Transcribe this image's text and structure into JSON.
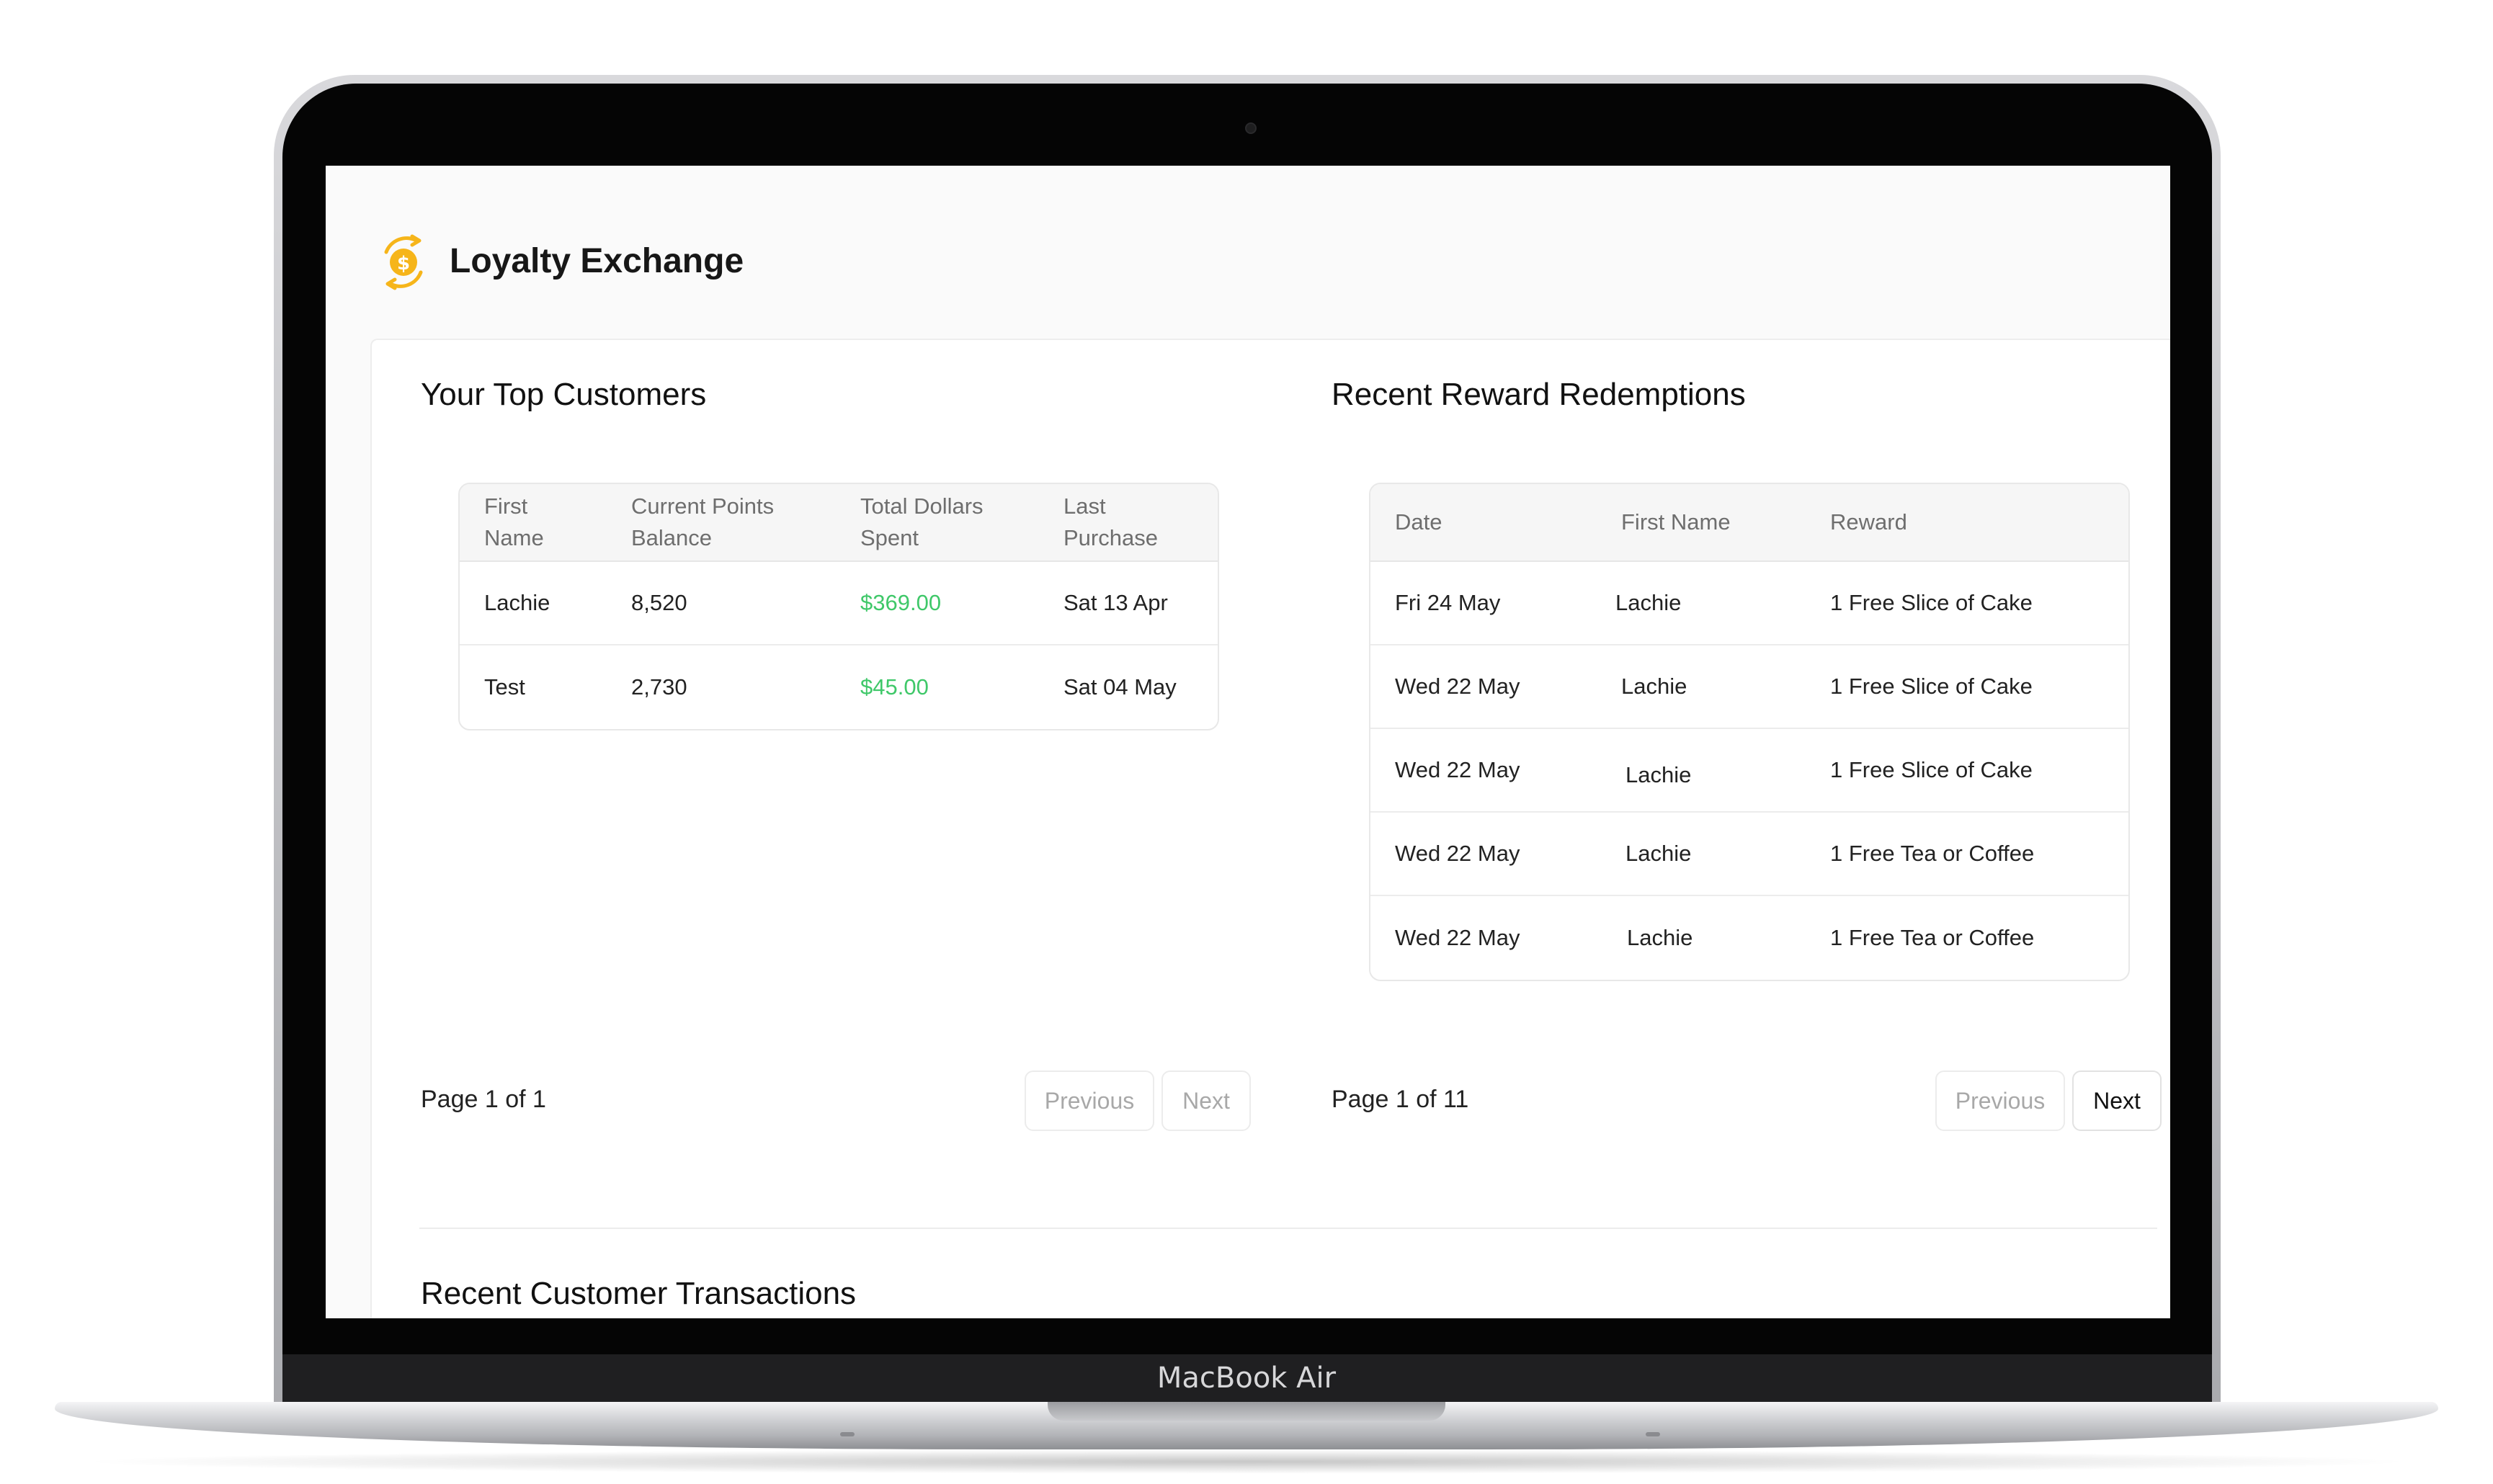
{
  "device": {
    "label": "MacBook Air"
  },
  "app": {
    "title": "Loyalty Exchange",
    "logo_icon": "coin-exchange-icon",
    "accent": "#f6b51a"
  },
  "top_customers": {
    "title": "Your Top Customers",
    "columns": [
      "First\nName",
      "Current Points\nBalance",
      "Total Dollars\nSpent",
      "Last\nPurchase"
    ],
    "rows": [
      {
        "first_name": "Lachie",
        "points": "8,520",
        "spent": "$369.00",
        "last_purchase": "Sat 13 Apr"
      },
      {
        "first_name": "Test",
        "points": "2,730",
        "spent": "$45.00",
        "last_purchase": "Sat 04 May"
      }
    ],
    "pagination": {
      "text": "Page 1 of 1",
      "previous": "Previous",
      "next": "Next"
    }
  },
  "redemptions": {
    "title": "Recent Reward Redemptions",
    "columns": [
      "Date",
      "First Name",
      "Reward"
    ],
    "rows": [
      {
        "date": "Fri 24 May",
        "first_name": "Lachie",
        "reward": "1 Free Slice of Cake"
      },
      {
        "date": "Wed 22 May",
        "first_name": "Lachie",
        "reward": "1 Free Slice of Cake"
      },
      {
        "date": "Wed 22 May",
        "first_name": "Lachie",
        "reward": "1 Free Slice of Cake"
      },
      {
        "date": "Wed 22 May",
        "first_name": "Lachie",
        "reward": "1 Free Tea or Coffee"
      },
      {
        "date": "Wed 22 May",
        "first_name": "Lachie",
        "reward": "1 Free Tea or Coffee"
      }
    ],
    "pagination": {
      "text": "Page 1 of 11",
      "previous": "Previous",
      "next": "Next"
    }
  },
  "transactions": {
    "title": "Recent Customer Transactions"
  },
  "colors": {
    "money": "#3fc869",
    "disabled_text": "#a8a8a8"
  }
}
